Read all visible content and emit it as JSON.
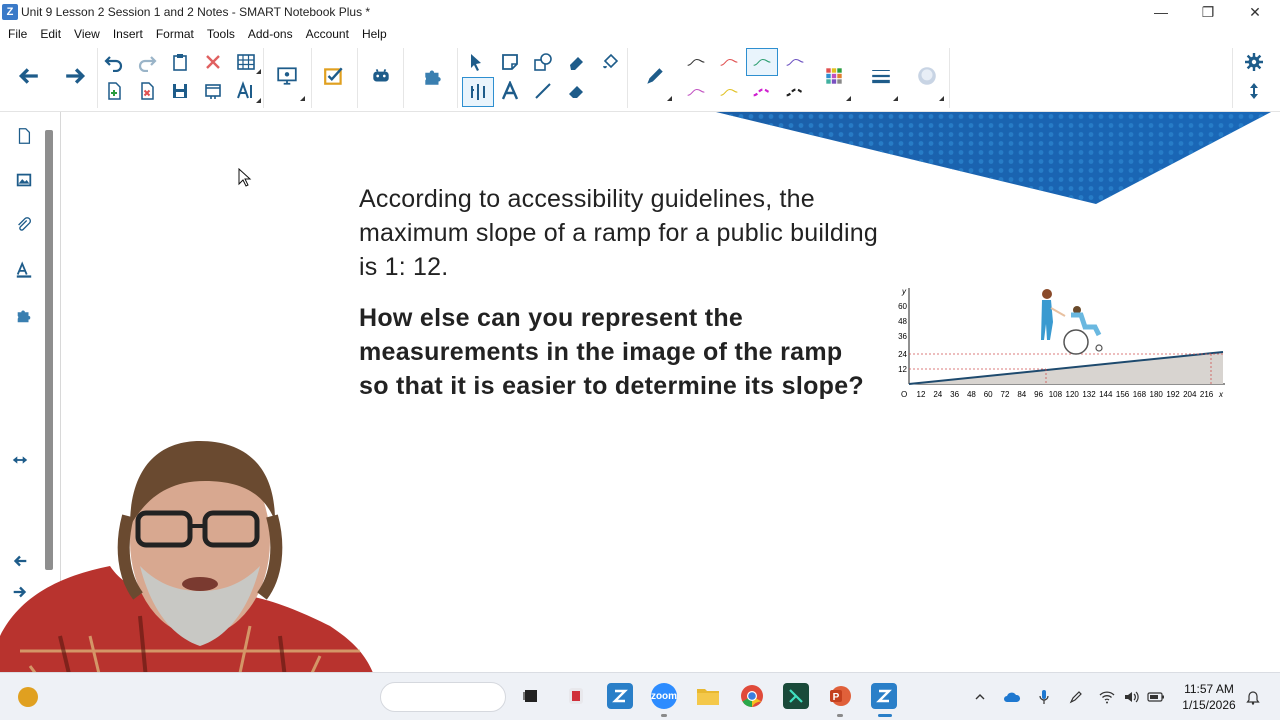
{
  "window": {
    "title": "Unit 9 Lesson 2 Session 1 and 2 Notes - SMART Notebook Plus *",
    "app_icon": "smart-notebook-icon",
    "minimize": "—",
    "restore": "❐",
    "close": "✕"
  },
  "menu": [
    "File",
    "Edit",
    "View",
    "Insert",
    "Format",
    "Tools",
    "Add-ons",
    "Account",
    "Help"
  ],
  "toolbar": {
    "selected_tool": "pen-style-teal",
    "pen_colors": [
      "#333333",
      "#e05050",
      "#2a9d6e",
      "#6a4fc0",
      "#c050c0",
      "#e0c020",
      "#d020d0",
      "#222222"
    ]
  },
  "slide": {
    "question": "According to accessibility guidelines, the maximum slope of a ramp for a public building is 1: 12.",
    "prompt": "How else can you represent the measurements in the image of the ramp so that it is easier to determine its slope?",
    "figure": {
      "y_axis_label": "y",
      "x_axis_label": "x",
      "origin_label": "O",
      "y_ticks": [
        "60",
        "48",
        "36",
        "24",
        "12"
      ],
      "x_ticks": [
        "12",
        "24",
        "36",
        "48",
        "60",
        "72",
        "84",
        "96",
        "108",
        "120",
        "132",
        "144",
        "156",
        "168",
        "180",
        "192",
        "204",
        "216"
      ]
    }
  },
  "taskbar": {
    "zoom_label": "zoom",
    "clock_time": "11:57 AM",
    "clock_date": "1/15/2026"
  },
  "colors": {
    "accent": "#2e8fd0",
    "banner": "#1f6fb8",
    "toolbar_icon": "#1e5c8a"
  }
}
